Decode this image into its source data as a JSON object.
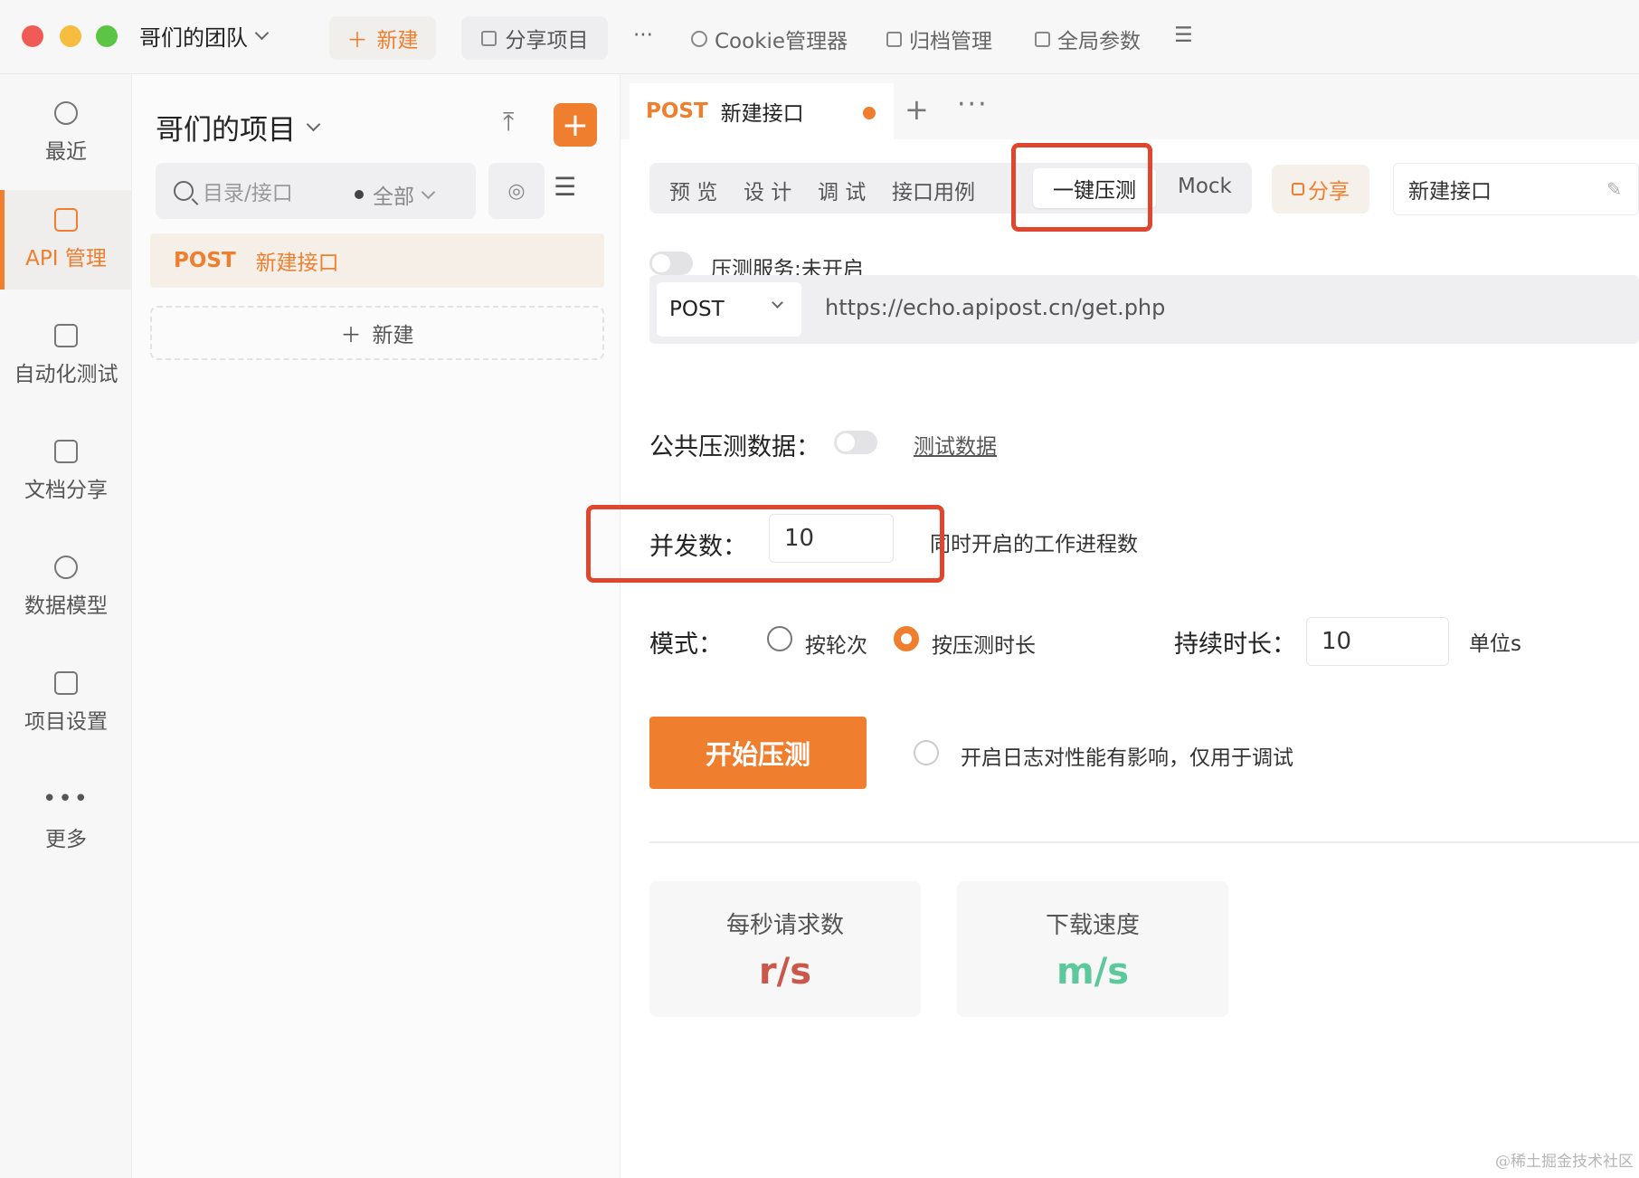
{
  "topbar": {
    "team": "哥们的团队",
    "new_button": "新建",
    "share_project": "分享项目",
    "more": "···",
    "cookie_manager": "Cookie管理器",
    "archive": "归档管理",
    "global_params": "全局参数"
  },
  "rail": {
    "items": [
      {
        "label": "最近",
        "icon": "history-icon"
      },
      {
        "label": "API 管理",
        "icon": "api-edit-icon"
      },
      {
        "label": "自动化测试",
        "icon": "flow-icon"
      },
      {
        "label": "文档分享",
        "icon": "document-icon"
      },
      {
        "label": "数据模型",
        "icon": "model-icon"
      },
      {
        "label": "项目设置",
        "icon": "settings-icon"
      },
      {
        "label": "更多",
        "icon": "more-icon"
      }
    ]
  },
  "project": {
    "title": "哥们的项目",
    "add": "+",
    "search_placeholder": "目录/接口",
    "filter": "全部",
    "api_method": "POST",
    "api_name": "新建接口",
    "add_new": "新建"
  },
  "tab": {
    "method": "POST",
    "name": "新建接口",
    "plus": "+",
    "more": "···"
  },
  "subtabs": [
    "预 览",
    "设 计",
    "调 试",
    "接口用例",
    "一键压测",
    "Mock"
  ],
  "share": "分享",
  "api_name_field": "新建接口",
  "stress": {
    "service_label": "压测服务:未开启",
    "method": "POST",
    "url": "https://echo.apipost.cn/get.php",
    "public_data_label": "公共压测数据：",
    "test_data_link": "测试数据",
    "concurrency_label": "并发数：",
    "concurrency_value": "10",
    "concurrency_hint": "同时开启的工作进程数",
    "mode_label": "模式：",
    "mode_by_rounds": "按轮次",
    "mode_by_duration": "按压测时长",
    "duration_label": "持续时长：",
    "duration_value": "10",
    "unit": "单位s",
    "start_button": "开始压测",
    "log_hint": "开启日志对性能有影响，仅用于调试"
  },
  "metrics": [
    {
      "title": "每秒请求数",
      "value": "r/s",
      "color": "#c9584a"
    },
    {
      "title": "下载速度",
      "value": "m/s",
      "color": "#5cc89b"
    }
  ],
  "watermark": "@稀土掘金技术社区",
  "colors": {
    "accent": "#ef7e2f",
    "highlight": "#e0452d"
  }
}
